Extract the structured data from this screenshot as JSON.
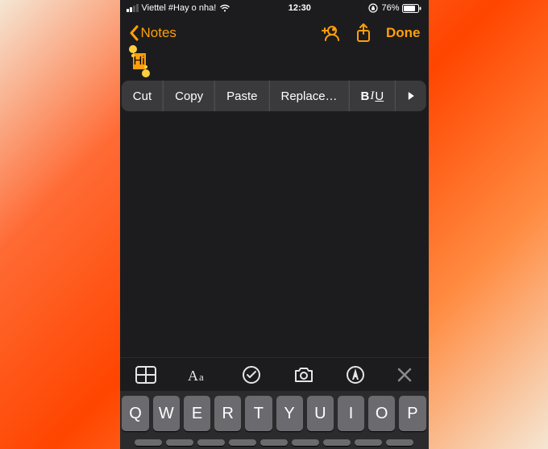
{
  "status": {
    "carrier": "Viettel #Hay o nha!",
    "time": "12:30",
    "battery_pct": "76%"
  },
  "nav": {
    "back_label": "Notes",
    "done": "Done"
  },
  "note": {
    "selected_text": "Hi"
  },
  "context_menu": {
    "cut": "Cut",
    "copy": "Copy",
    "paste": "Paste",
    "replace": "Replace…",
    "biu_b": "B",
    "biu_i": "I",
    "biu_u": "U"
  },
  "keyboard": {
    "row1": [
      "Q",
      "W",
      "E",
      "R",
      "T",
      "Y",
      "U",
      "I",
      "O",
      "P"
    ]
  },
  "icons": {
    "add_person": "add-person-icon",
    "share": "share-icon",
    "back": "chevron-left-icon",
    "rotation_lock": "rotation-lock-icon",
    "wifi": "wifi-icon",
    "table": "table-icon",
    "format": "format-icon",
    "checklist": "checklist-icon",
    "camera": "camera-icon",
    "markup": "markup-icon",
    "close": "close-icon",
    "arrow_more": "arrow-right-icon"
  }
}
